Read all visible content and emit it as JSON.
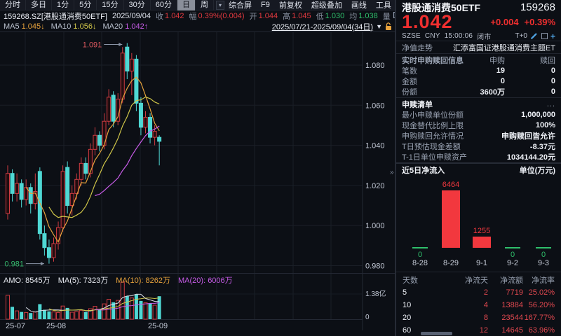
{
  "toolbar": {
    "tabs": [
      "分时",
      "多日",
      "1分",
      "5分",
      "15分",
      "30分",
      "60分",
      "日",
      "周"
    ],
    "active_index": 7,
    "caret": "▾",
    "tools": [
      "综合屏",
      "F9",
      "前复权",
      "超级叠加",
      "画线",
      "工具"
    ],
    "gear": "⚙",
    "help": "?",
    "chevron": ">"
  },
  "quote": {
    "symbol": "159268.SZ[港股通消费50ETF]",
    "date": "2025/09/04",
    "close_label": "收",
    "close": "1.042",
    "chg_label": "幅",
    "chg": "0.39%(0.004)",
    "open_label": "开",
    "open": "1.044",
    "high_label": "高",
    "high": "1.045",
    "low_label": "低",
    "low": "1.030",
    "avg_label": "均",
    "avg": "1.038",
    "vol_label": "量"
  },
  "ma_bar": {
    "ma5_label": "MA5",
    "ma5": "1.045↓",
    "ma10_label": "MA10",
    "ma10": "1.056↓",
    "ma20_label": "MA20",
    "ma20": "1.042↑",
    "range": "2025/07/21-2025/09/04(34日)",
    "caret": "▼"
  },
  "amo_bar": {
    "amo": "AMO: 8545万",
    "ma5": "MA(5): 7323万",
    "ma10": "MA(10): 8262万",
    "ma20": "MA(20): 6006万"
  },
  "expander": "»",
  "chart_data": [
    {
      "type": "candlestick",
      "title": "港股通消费50ETF 日K 2025/07/21-2025/09/04(34日)",
      "ylim": [
        0.975,
        1.095
      ],
      "grid": true,
      "y_axis": [
        {
          "label": "1.080",
          "price": 1.08
        },
        {
          "label": "1.060",
          "price": 1.06
        },
        {
          "label": "1.040",
          "price": 1.04
        },
        {
          "label": "1.020",
          "price": 1.02
        },
        {
          "label": "1.000",
          "price": 1.0
        },
        {
          "label": "0.980",
          "price": 0.98
        }
      ],
      "x_axis": [
        {
          "label": "25-07",
          "x": 8
        },
        {
          "label": "25-08",
          "x": 66
        },
        {
          "label": "25-09",
          "x": 211
        }
      ],
      "annotations": [
        {
          "text": "1.091",
          "type": "high"
        },
        {
          "text": "0.981",
          "type": "low"
        }
      ],
      "ohlc": [
        [
          1.006,
          1.03,
          1.003,
          1.026
        ],
        [
          1.026,
          1.028,
          1.012,
          1.016
        ],
        [
          1.016,
          1.026,
          1.012,
          1.021
        ],
        [
          1.021,
          1.023,
          1.009,
          1.013
        ],
        [
          1.013,
          1.023,
          1.01,
          1.019
        ],
        [
          1.019,
          1.021,
          1.006,
          1.011
        ],
        [
          1.011,
          1.026,
          1.008,
          1.017
        ],
        [
          1.027,
          1.029,
          0.993,
          0.996
        ],
        [
          0.996,
          1.0,
          0.985,
          0.989
        ],
        [
          0.989,
          0.993,
          0.981,
          0.984
        ],
        [
          0.984,
          0.994,
          0.982,
          0.991
        ],
        [
          0.991,
          1.002,
          0.988,
          0.999
        ],
        [
          0.999,
          1.03,
          0.997,
          1.027
        ],
        [
          1.029,
          1.032,
          1.006,
          1.01
        ],
        [
          1.01,
          1.02,
          1.005,
          1.016
        ],
        [
          1.016,
          1.026,
          1.013,
          1.023
        ],
        [
          1.023,
          1.034,
          1.02,
          1.031
        ],
        [
          1.031,
          1.034,
          1.023,
          1.026
        ],
        [
          1.026,
          1.041,
          1.024,
          1.038
        ],
        [
          1.038,
          1.049,
          1.035,
          1.045
        ],
        [
          1.045,
          1.047,
          1.037,
          1.04
        ],
        [
          1.04,
          1.056,
          1.038,
          1.052
        ],
        [
          1.052,
          1.068,
          1.05,
          1.064
        ],
        [
          1.065,
          1.067,
          1.049,
          1.052
        ],
        [
          1.052,
          1.066,
          1.05,
          1.063
        ],
        [
          1.063,
          1.089,
          1.061,
          1.086
        ],
        [
          1.089,
          1.091,
          1.073,
          1.077
        ],
        [
          1.077,
          1.086,
          1.065,
          1.083
        ],
        [
          1.083,
          1.085,
          1.057,
          1.061
        ],
        [
          1.061,
          1.064,
          1.045,
          1.049
        ],
        [
          1.049,
          1.057,
          1.046,
          1.054
        ],
        [
          1.054,
          1.056,
          1.041,
          1.044
        ],
        [
          1.044,
          1.05,
          1.04,
          1.047
        ],
        [
          1.044,
          1.045,
          1.03,
          1.042
        ]
      ],
      "volumes": [
        8900,
        4600,
        3100,
        2700,
        2500,
        2300,
        2700,
        5600,
        3500,
        2900,
        2700,
        2500,
        4900,
        4200,
        2600,
        2900,
        3300,
        2700,
        3900,
        4800,
        3600,
        5700,
        7400,
        6300,
        7000,
        13800,
        8600,
        7900,
        9200,
        6800,
        6100,
        5900,
        5200,
        8545
      ],
      "volume_axis": [
        {
          "label": "1.38亿",
          "y": 423
        },
        {
          "label": "0",
          "y": 456
        }
      ]
    },
    {
      "type": "bar",
      "title": "近5日净流入",
      "unit": "单位(万元)",
      "categories": [
        "8-28",
        "8-29",
        "9-1",
        "9-2",
        "9-3"
      ],
      "values": [
        0,
        6464,
        1255,
        0,
        0
      ]
    }
  ],
  "panel": {
    "name": "港股通消费50ETF",
    "code": "159268",
    "price": "1.042",
    "change": "+0.004",
    "change_pct": "+0.39%",
    "market": "SZSE",
    "currency": "CNY",
    "time": "15:00:06",
    "status": "闭市",
    "t0": "T+0",
    "nav_label": "净值走势",
    "nav_value": "汇添富国证港股通消费主题ET",
    "realtime": {
      "title": "实时申购赎回信息",
      "col_sub": "申购",
      "col_red": "赎回",
      "rows": [
        {
          "label": "笔数",
          "sub": "19",
          "red": "0"
        },
        {
          "label": "金额",
          "sub": "0",
          "red": "0"
        },
        {
          "label": "份额",
          "sub": "3600万",
          "red": "0"
        }
      ]
    },
    "redemption": {
      "title": "申赎清单",
      "more": "...",
      "rows": [
        {
          "label": "最小申赎单位份额",
          "value": "1,000,000"
        },
        {
          "label": "现金替代比例上限",
          "value": "100%"
        },
        {
          "label": "申购赎回允许情况",
          "value": "申购赎回皆允许"
        },
        {
          "label": "T日预估现金差额",
          "value": "-8.37元"
        },
        {
          "label": "T-1日单位申赎资产",
          "value": "1034144.20元"
        }
      ]
    },
    "flow": {
      "title": "近5日净流入",
      "unit": "单位(万元)"
    },
    "flow_table": {
      "headers": [
        "天数",
        "净流天",
        "净流额",
        "净流率"
      ],
      "rows": [
        {
          "days": "5",
          "net_days": "2",
          "amount": "7719",
          "rate": "25.02%"
        },
        {
          "days": "10",
          "net_days": "4",
          "amount": "13884",
          "rate": "56.20%"
        },
        {
          "days": "20",
          "net_days": "8",
          "amount": "23544",
          "rate": "167.77%"
        },
        {
          "days": "60",
          "net_days": "12",
          "amount": "14645",
          "rate": "63.96%"
        }
      ]
    }
  },
  "colors": {
    "up": "#cf3b41",
    "down": "#4fd8d4",
    "price_red": "#ef2f2f",
    "green": "#2fbf6b",
    "ma5": "#e6a23c",
    "ma10": "#cfc549",
    "ma20": "#c85ce8",
    "flow_bar": "#f2383e"
  }
}
